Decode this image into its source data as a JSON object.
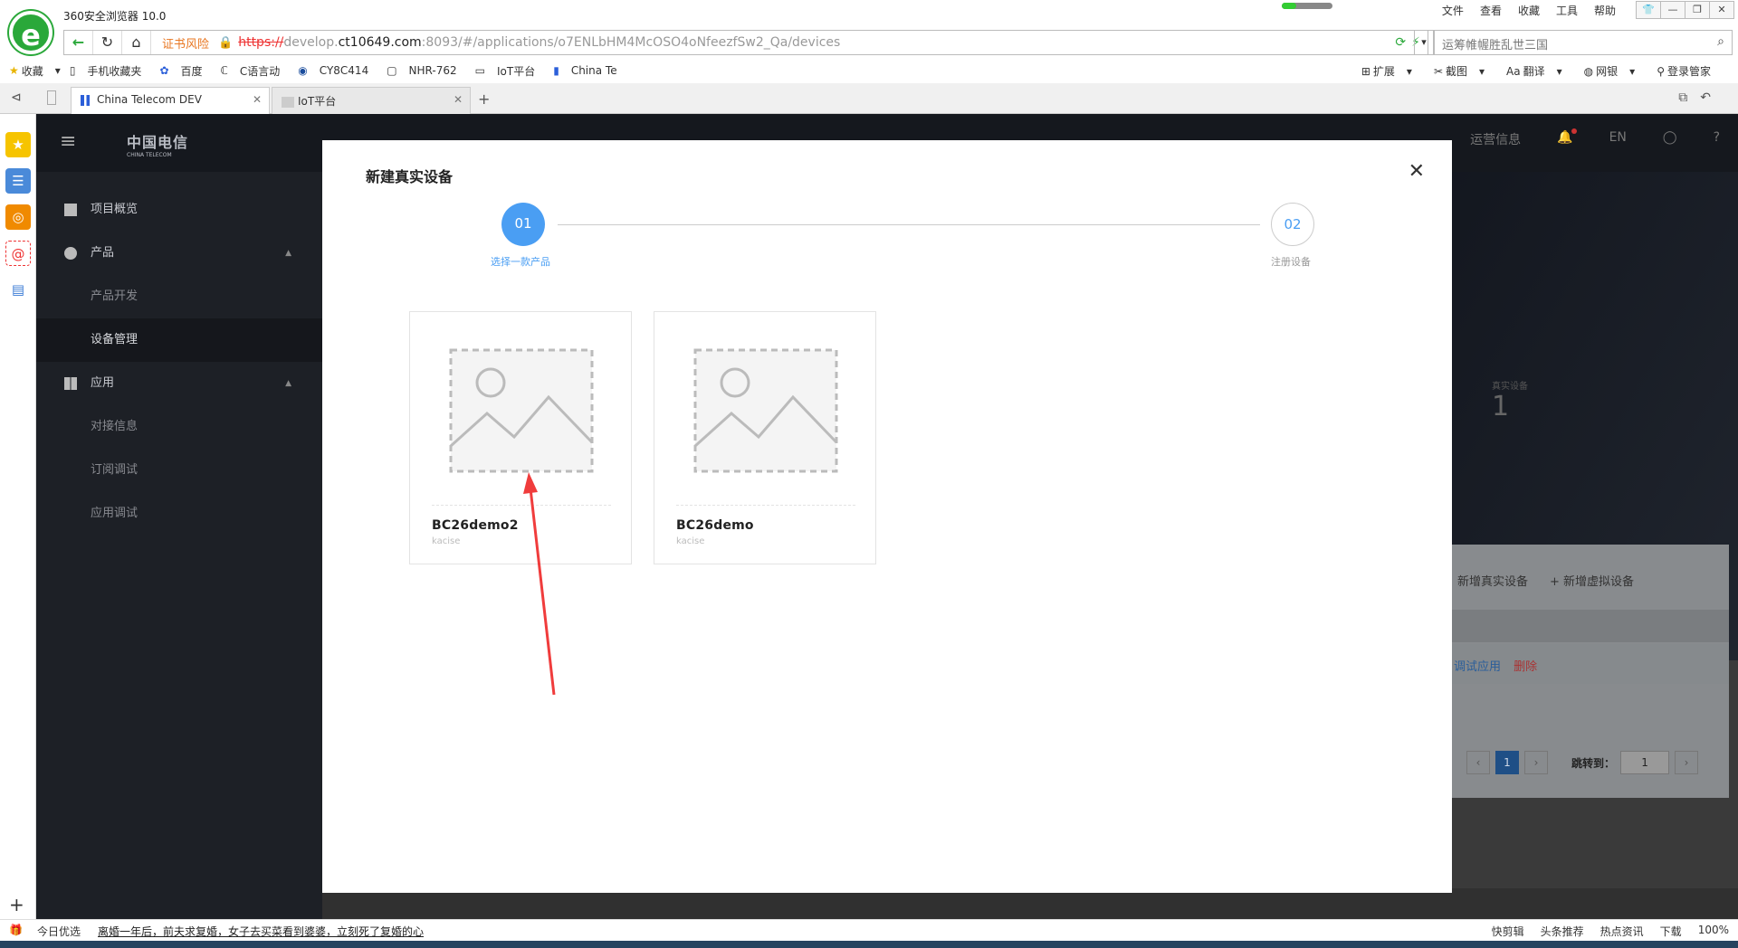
{
  "browser": {
    "app_title": "360安全浏览器 10.0",
    "menu": [
      "文件",
      "查看",
      "收藏",
      "工具",
      "帮助"
    ],
    "window_buttons": [
      "👕",
      "—",
      "❐",
      "✕"
    ],
    "risk_label": "证书风险",
    "url_proto": "https://",
    "url_pre": "develop.",
    "url_host": "ct10649.com",
    "url_rest": ":8093/#/applications/o7ENLbHM4McOSO4oNfeezfSw2_Qa/devices",
    "search_placeholder": "运筹帷幄胜乱世三国",
    "bookmarks": [
      "收藏",
      "手机收藏夹",
      "百度",
      "C语言动",
      "CY8C414",
      "NHR-762",
      "IoT平台",
      "China Te"
    ],
    "bookmark_tools": [
      "扩展",
      "截图",
      "翻译",
      "网银",
      "登录管家"
    ],
    "tabs": [
      {
        "title": "China Telecom DEV",
        "active": true
      },
      {
        "title": "IoT平台",
        "active": false
      }
    ]
  },
  "site": {
    "logo": "中国电信",
    "logo_sub": "CHINA TELECOM",
    "header_links": [
      "运营信息",
      "EN"
    ],
    "menu": {
      "overview": "项目概览",
      "product": "产品",
      "product_dev": "产品开发",
      "device_mgmt": "设备管理",
      "application": "应用",
      "integration": "对接信息",
      "subscription_debug": "订阅调试",
      "app_debug": "应用调试"
    },
    "stat_label": "真实设备",
    "stat_value": "1",
    "add_real_device": "新增真实设备",
    "add_virtual_device": "+ 新增虚拟设备",
    "op_debug": "调试应用",
    "op_delete": "删除",
    "pager_current": "1",
    "jump_label": "跳转到：",
    "jump_value": "1"
  },
  "modal": {
    "title": "新建真实设备",
    "close": "✕",
    "step1_num": "01",
    "step1_label": "选择一款产品",
    "step2_num": "02",
    "step2_label": "注册设备",
    "products": [
      {
        "name": "BC26demo2",
        "owner": "kacise"
      },
      {
        "name": "BC26demo",
        "owner": "kacise"
      }
    ]
  },
  "statusbar": {
    "left": "今日优选",
    "news": "离婚一年后，前夫求复婚，女子去买菜看到婆婆，立刻死了复婚的心",
    "right": [
      "快剪辑",
      "头条推荐",
      "热点资讯",
      "下载",
      "100%"
    ]
  },
  "colors": {
    "accent": "#4a9ef3",
    "brand_green": "#2aa83a",
    "arrow": "#f03c3c"
  }
}
